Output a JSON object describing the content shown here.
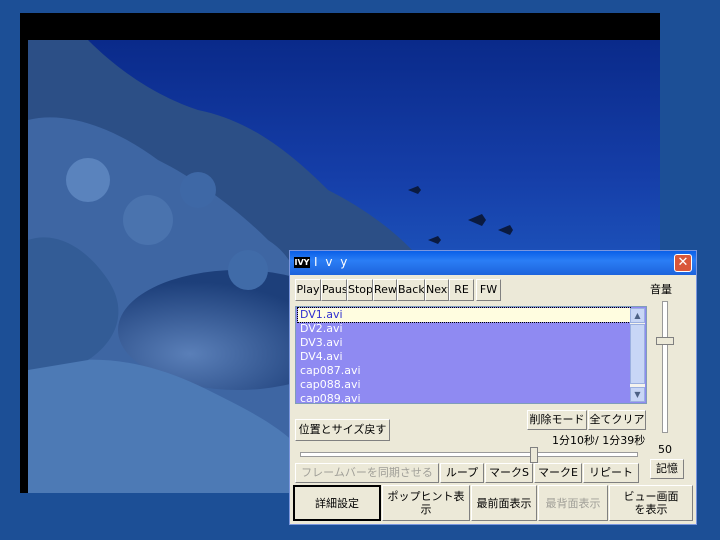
{
  "app": {
    "icon_text": "IVY",
    "title": "I v y",
    "close_glyph": "✕"
  },
  "transport": [
    "Play",
    "Paus",
    "Stop",
    "Rew",
    "Back",
    "Next",
    "RE",
    "FW"
  ],
  "volume": {
    "label": "音量",
    "value": "50",
    "level": 50
  },
  "playlist": {
    "items": [
      "DV1.avi",
      "DV2.avi",
      "DV3.avi",
      "DV4.avi",
      "cap087.avi",
      "cap088.avi",
      "cap089.avi"
    ],
    "selected_index": 0
  },
  "controls": {
    "delete_mode": "削除モード",
    "clear_all": "全てクリア",
    "restore_position": "位置とサイズ戻す",
    "time": "1分10秒/ 1分39秒",
    "memory": "記憶",
    "sync_framebar": "フレームバーを同期させる",
    "loop": "ループ",
    "mark_s": "マークS",
    "mark_e": "マークE",
    "repeat": "リピート"
  },
  "seek": {
    "current": "1分10秒",
    "total": "1分39秒",
    "fraction": 0.707
  },
  "bottom": {
    "details": "詳細設定",
    "popup_hint": "ポップヒント表示",
    "front": "最前面表示",
    "back": "最背面表示",
    "view_line1": "ビュー画面",
    "view_line2": "を表示"
  },
  "colors": {
    "title_bar": "#1d63dc",
    "list_bg": "#8f8af2",
    "desktop": "#1c4f96"
  }
}
